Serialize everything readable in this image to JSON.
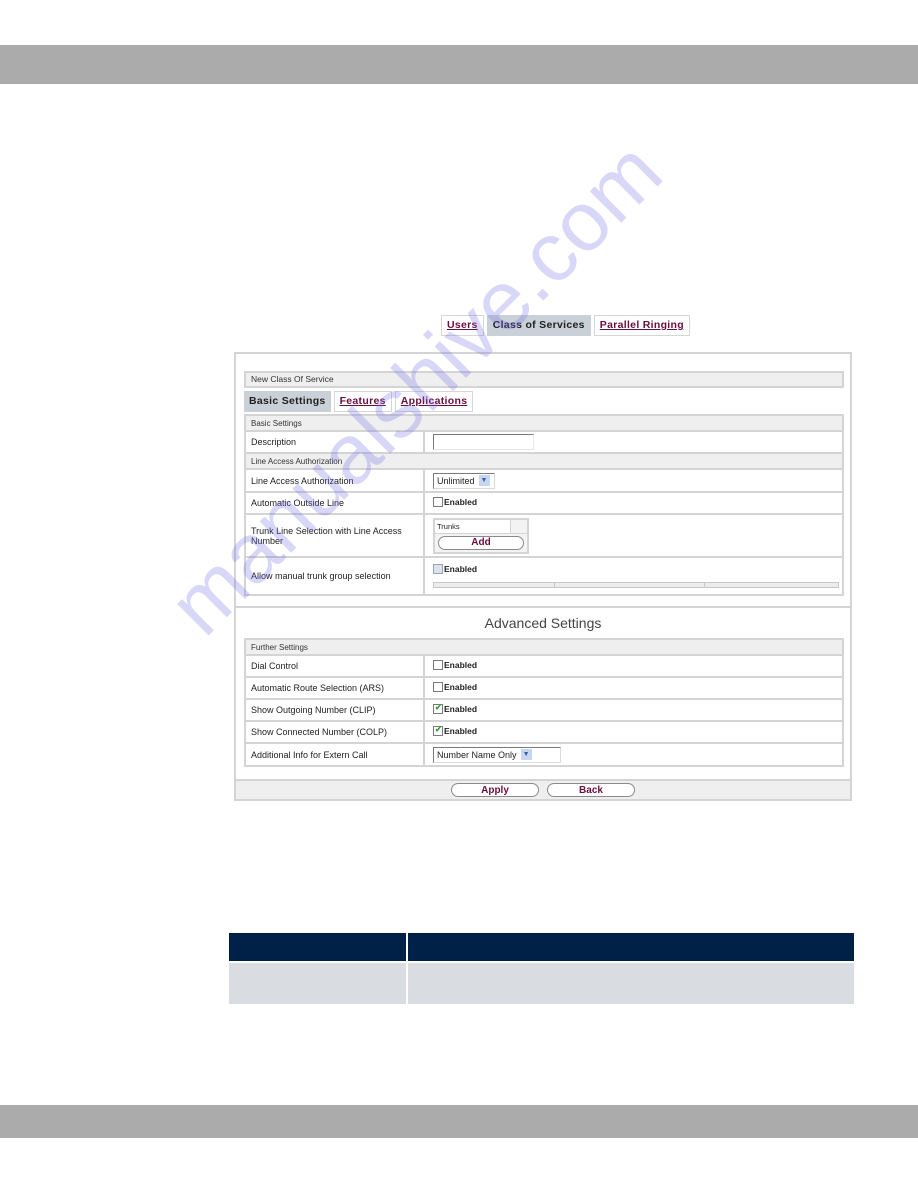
{
  "nav_tabs": [
    {
      "label": "Users",
      "active": false
    },
    {
      "label": "Class of Services",
      "active": true
    },
    {
      "label": "Parallel Ringing",
      "active": false
    }
  ],
  "panel": {
    "title": "New Class Of Service",
    "sub_tabs": [
      {
        "label": "Basic Settings",
        "active": true
      },
      {
        "label": "Features",
        "active": false
      },
      {
        "label": "Applications",
        "active": false
      }
    ],
    "basic_settings": {
      "header": "Basic Settings",
      "description_label": "Description",
      "description_value": ""
    },
    "line_access": {
      "header": "Line Access Authorization",
      "authorization_label": "Line Access Authorization",
      "authorization_value": "Unlimited",
      "outside_line_label": "Automatic Outside Line",
      "outside_line_checkbox": "Enabled",
      "outside_line_checked": false,
      "trunk_selection_label": "Trunk Line Selection with Line Access Number",
      "trunks_column": "Trunks",
      "add_label": "Add",
      "manual_trunk_label": "Allow manual trunk group selection",
      "manual_trunk_checkbox": "Enabled",
      "manual_trunk_checked": false
    },
    "advanced_title": "Advanced Settings",
    "further_settings": {
      "header": "Further Settings",
      "rows": [
        {
          "label": "Dial Control",
          "checkbox": "Enabled",
          "checked": false
        },
        {
          "label": "Automatic Route Selection (ARS)",
          "checkbox": "Enabled",
          "checked": false
        },
        {
          "label": "Show Outgoing Number (CLIP)",
          "checkbox": "Enabled",
          "checked": true
        },
        {
          "label": "Show Connected Number (COLP)",
          "checkbox": "Enabled",
          "checked": true
        }
      ],
      "extern_call_label": "Additional Info for Extern Call",
      "extern_call_value": "Number Name Only"
    },
    "apply_label": "Apply",
    "back_label": "Back"
  },
  "watermark": "manualshive.com",
  "colors": {
    "link": "#6b0d3e",
    "active_tab": "#c9d0d8",
    "table_header": "#002147",
    "table_row": "#d9dde1",
    "bar": "#ababab"
  }
}
